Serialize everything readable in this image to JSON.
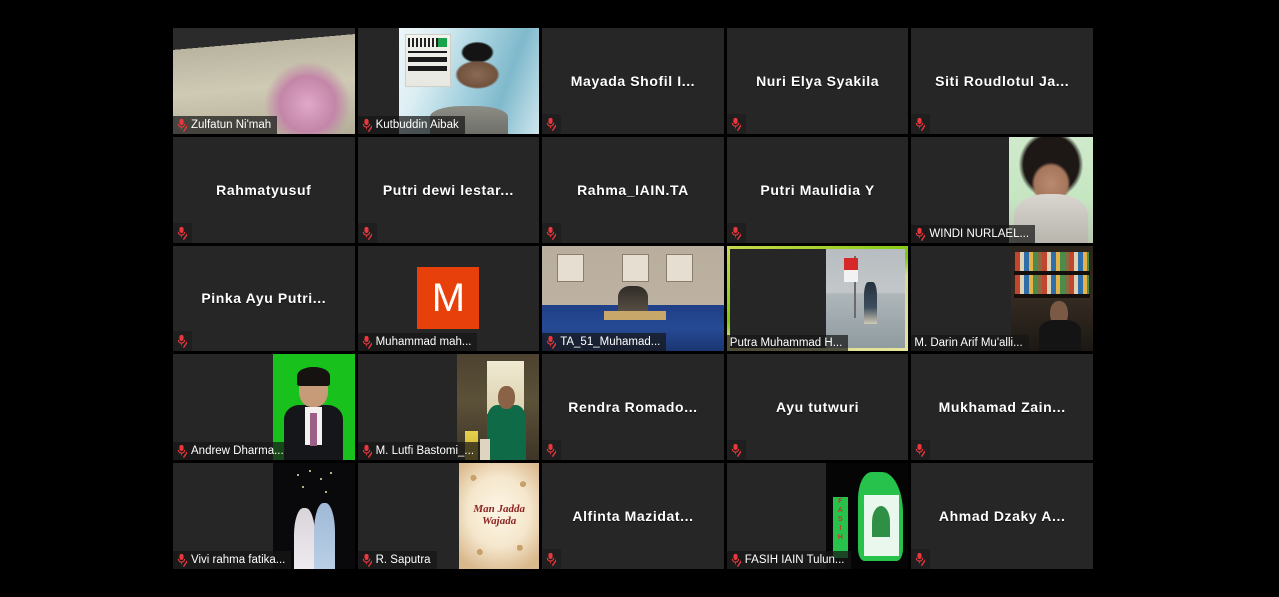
{
  "app": {
    "name": "Zoom Meeting",
    "view": "Gallery View",
    "background_color": "#000000",
    "tile_color": "#262626",
    "active_speaker_border_color": "#cddc39",
    "mic_muted_color": "#e8373d"
  },
  "grid": {
    "columns": 5,
    "rows": 5,
    "participant_count": 25
  },
  "icons": {
    "mic_muted": "mic-muted-icon"
  },
  "participants": [
    {
      "name": "Zulfatun Ni'mah",
      "display": "Zulfatun Ni'mah",
      "video": true,
      "muted": true,
      "active": false,
      "art": "v-zulfatun",
      "art_mode": "full"
    },
    {
      "name": "Kutbuddin Aibak",
      "display": "Kutbuddin Aibak",
      "video": true,
      "muted": true,
      "active": false,
      "art": "v-kutbuddin",
      "art_mode": "box"
    },
    {
      "name": "Mayada Shofil I...",
      "display": "Mayada Shofil I...",
      "video": false,
      "muted": true,
      "active": false,
      "art": "",
      "art_mode": "none"
    },
    {
      "name": "Nuri Elya Syakila",
      "display": "Nuri Elya Syakila",
      "video": false,
      "muted": true,
      "active": false,
      "art": "",
      "art_mode": "none"
    },
    {
      "name": "Siti Roudlotul Ja...",
      "display": "Siti Roudlotul Ja...",
      "video": false,
      "muted": true,
      "active": false,
      "art": "",
      "art_mode": "none"
    },
    {
      "name": "Rahmatyusuf",
      "display": "Rahmatyusuf",
      "video": false,
      "muted": true,
      "active": false,
      "art": "",
      "art_mode": "none"
    },
    {
      "name": "Putri dewi lestar...",
      "display": "Putri dewi lestar...",
      "video": false,
      "muted": true,
      "active": false,
      "art": "",
      "art_mode": "none"
    },
    {
      "name": "Rahma_IAIN.TA",
      "display": "Rahma_IAIN.TA",
      "video": false,
      "muted": true,
      "active": false,
      "art": "",
      "art_mode": "none"
    },
    {
      "name": "Putri Maulidia Y",
      "display": "Putri Maulidia Y",
      "video": false,
      "muted": true,
      "active": false,
      "art": "",
      "art_mode": "none"
    },
    {
      "name": "WINDI NURLAEL...",
      "display": "WINDI NURLAEL...",
      "video": true,
      "muted": true,
      "active": false,
      "art": "v-windi",
      "art_mode": "box"
    },
    {
      "name": "Pinka Ayu Putri...",
      "display": "Pinka Ayu Putri...",
      "video": false,
      "muted": true,
      "active": false,
      "art": "",
      "art_mode": "none"
    },
    {
      "name": "Muhammad mah...",
      "display": "Muhammad mah...",
      "video": true,
      "muted": true,
      "active": false,
      "art": "avatar-M",
      "art_mode": "avatar",
      "avatar_letter": "M",
      "avatar_color": "#e8400a"
    },
    {
      "name": "TA_51_Muhamad...",
      "display": "TA_51_Muhamad...",
      "video": true,
      "muted": true,
      "active": false,
      "art": "v-ta51",
      "art_mode": "full"
    },
    {
      "name": "Putra Muhammad H...",
      "display": "Putra Muhammad H...",
      "video": true,
      "muted": false,
      "active": true,
      "art": "v-putra",
      "art_mode": "box"
    },
    {
      "name": "M. Darin Arif Mu'alli...",
      "display": "M. Darin Arif Mu'alli...",
      "video": true,
      "muted": false,
      "active": false,
      "art": "v-darin",
      "art_mode": "box"
    },
    {
      "name": "Andrew Dharma...",
      "display": "Andrew Dharma...",
      "video": true,
      "muted": true,
      "active": false,
      "art": "v-andrew",
      "art_mode": "box"
    },
    {
      "name": "M. Lutfi Bastomi_...",
      "display": "M. Lutfi Bastomi_...",
      "video": true,
      "muted": true,
      "active": false,
      "art": "v-lutfi",
      "art_mode": "box"
    },
    {
      "name": "Rendra Romado...",
      "display": "Rendra Romado...",
      "video": false,
      "muted": true,
      "active": false,
      "art": "",
      "art_mode": "none"
    },
    {
      "name": "Ayu tutwuri",
      "display": "Ayu tutwuri",
      "video": false,
      "muted": true,
      "active": false,
      "art": "",
      "art_mode": "none"
    },
    {
      "name": "Mukhamad Zain...",
      "display": "Mukhamad Zain...",
      "video": false,
      "muted": true,
      "active": false,
      "art": "",
      "art_mode": "none"
    },
    {
      "name": "Vivi rahma fatika...",
      "display": "Vivi rahma fatika...",
      "video": true,
      "muted": true,
      "active": false,
      "art": "v-vivi",
      "art_mode": "box"
    },
    {
      "name": "R. Saputra",
      "display": "R. Saputra",
      "video": true,
      "muted": true,
      "active": false,
      "art": "v-saputra",
      "art_mode": "box",
      "art_text_line1": "Man Jadda",
      "art_text_line2": "Wajada"
    },
    {
      "name": "Alfinta Mazidat...",
      "display": "Alfinta Mazidat...",
      "video": false,
      "muted": true,
      "active": false,
      "art": "",
      "art_mode": "none"
    },
    {
      "name": "FASIH IAIN Tulun...",
      "display": "FASIH IAIN Tulun...",
      "video": true,
      "muted": true,
      "active": false,
      "art": "v-fasih",
      "art_mode": "box"
    },
    {
      "name": "Ahmad Dzaky A...",
      "display": "Ahmad Dzaky A...",
      "video": false,
      "muted": true,
      "active": false,
      "art": "",
      "art_mode": "none"
    }
  ]
}
